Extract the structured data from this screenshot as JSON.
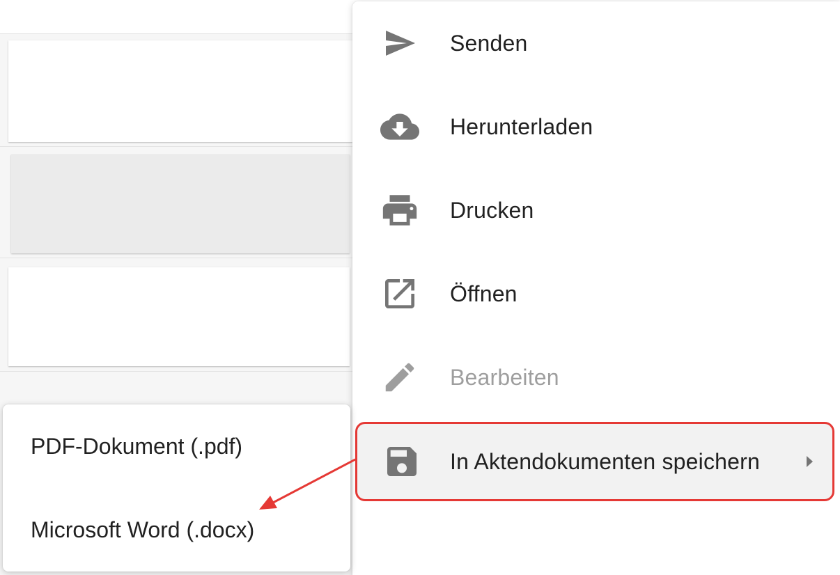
{
  "menu": {
    "items": [
      {
        "label": "Senden",
        "icon": "send-icon"
      },
      {
        "label": "Herunterladen",
        "icon": "cloud-download-icon"
      },
      {
        "label": "Drucken",
        "icon": "printer-icon"
      },
      {
        "label": "Öffnen",
        "icon": "open-in-new-icon"
      },
      {
        "label": "Bearbeiten",
        "icon": "pencil-icon",
        "disabled": true
      },
      {
        "label": "In Aktendokumenten speichern",
        "icon": "save-icon",
        "has_submenu": true
      }
    ]
  },
  "submenu": {
    "items": [
      {
        "label": "PDF-Dokument (.pdf)"
      },
      {
        "label": "Microsoft Word (.docx)"
      }
    ]
  },
  "colors": {
    "highlight_border": "#e53935",
    "annotation_arrow": "#e53935",
    "icon": "#757575",
    "disabled_icon": "#9e9e9e"
  }
}
